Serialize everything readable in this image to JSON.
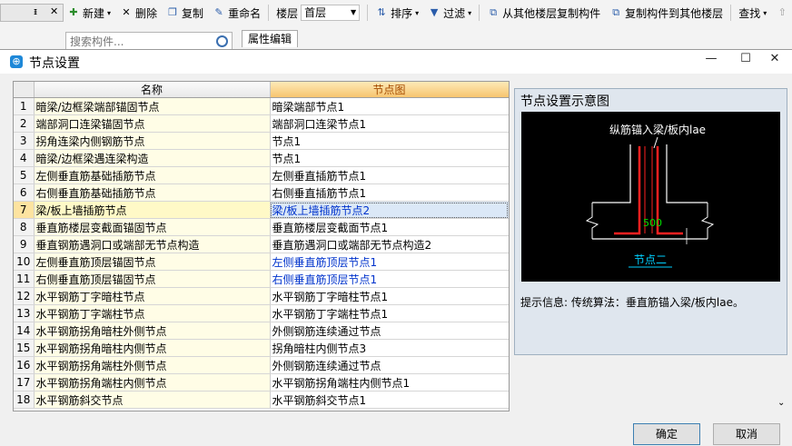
{
  "toolbar": {
    "new": "新建",
    "delete": "删除",
    "copy": "复制",
    "rename": "重命名",
    "floor_label": "楼层",
    "floor_value": "首层",
    "sort": "排序",
    "filter": "过滤",
    "copy_from_other": "从其他楼层复制构件",
    "copy_to_other": "复制构件到其他楼层",
    "find": "查找"
  },
  "search": {
    "placeholder": "搜索构件..."
  },
  "property_tab": "属性编辑",
  "dialog": {
    "title": "节点设置",
    "columns": {
      "name": "名称",
      "node": "节点图"
    },
    "rows": [
      {
        "no": "1",
        "name": "暗梁/边框梁端部锚固节点",
        "node": "暗梁端部节点1"
      },
      {
        "no": "2",
        "name": "端部洞口连梁锚固节点",
        "node": "端部洞口连梁节点1"
      },
      {
        "no": "3",
        "name": "拐角连梁内侧钢筋节点",
        "node": "节点1"
      },
      {
        "no": "4",
        "name": "暗梁/边框梁遇连梁构造",
        "node": "节点1"
      },
      {
        "no": "5",
        "name": "左侧垂直筋基础插筋节点",
        "node": "左侧垂直插筋节点1"
      },
      {
        "no": "6",
        "name": "右侧垂直筋基础插筋节点",
        "node": "右侧垂直插筋节点1"
      },
      {
        "no": "7",
        "name": "梁/板上墙插筋节点",
        "node": "梁/板上墙插筋节点2"
      },
      {
        "no": "8",
        "name": "垂直筋楼层变截面锚固节点",
        "node": "垂直筋楼层变截面节点1"
      },
      {
        "no": "9",
        "name": "垂直钢筋遇洞口或端部无节点构造",
        "node": "垂直筋遇洞口或端部无节点构造2"
      },
      {
        "no": "10",
        "name": "左侧垂直筋顶层锚固节点",
        "node": "左侧垂直筋顶层节点1"
      },
      {
        "no": "11",
        "name": "右侧垂直筋顶层锚固节点",
        "node": "右侧垂直筋顶层节点1"
      },
      {
        "no": "12",
        "name": "水平钢筋丁字暗柱节点",
        "node": "水平钢筋丁字暗柱节点1"
      },
      {
        "no": "13",
        "name": "水平钢筋丁字端柱节点",
        "node": "水平钢筋丁字端柱节点1"
      },
      {
        "no": "14",
        "name": "水平钢筋拐角暗柱外侧节点",
        "node": "外侧钢筋连续通过节点"
      },
      {
        "no": "15",
        "name": "水平钢筋拐角暗柱内侧节点",
        "node": "拐角暗柱内侧节点3"
      },
      {
        "no": "16",
        "name": "水平钢筋拐角端柱外侧节点",
        "node": "外侧钢筋连续通过节点"
      },
      {
        "no": "17",
        "name": "水平钢筋拐角端柱内侧节点",
        "node": "水平钢筋拐角端柱内侧节点1"
      },
      {
        "no": "18",
        "name": "水平钢筋斜交节点",
        "node": "水平钢筋斜交节点1"
      }
    ],
    "preview": {
      "title": "节点设置示意图",
      "diagram_caption": "纵筋锚入梁/板内lae",
      "dimension": "500",
      "node_label": "节点二",
      "hint_label": "提示信息:",
      "hint_text": "传统算法：垂直筋锚入梁/板内lae。"
    },
    "ok": "确定",
    "cancel": "取消"
  },
  "colors": {
    "accent": "#f7c56f",
    "link": "#0033cc",
    "selection": "#dbe8f7",
    "rebar": "#ff2020",
    "window_icon": "#1e88d8"
  }
}
